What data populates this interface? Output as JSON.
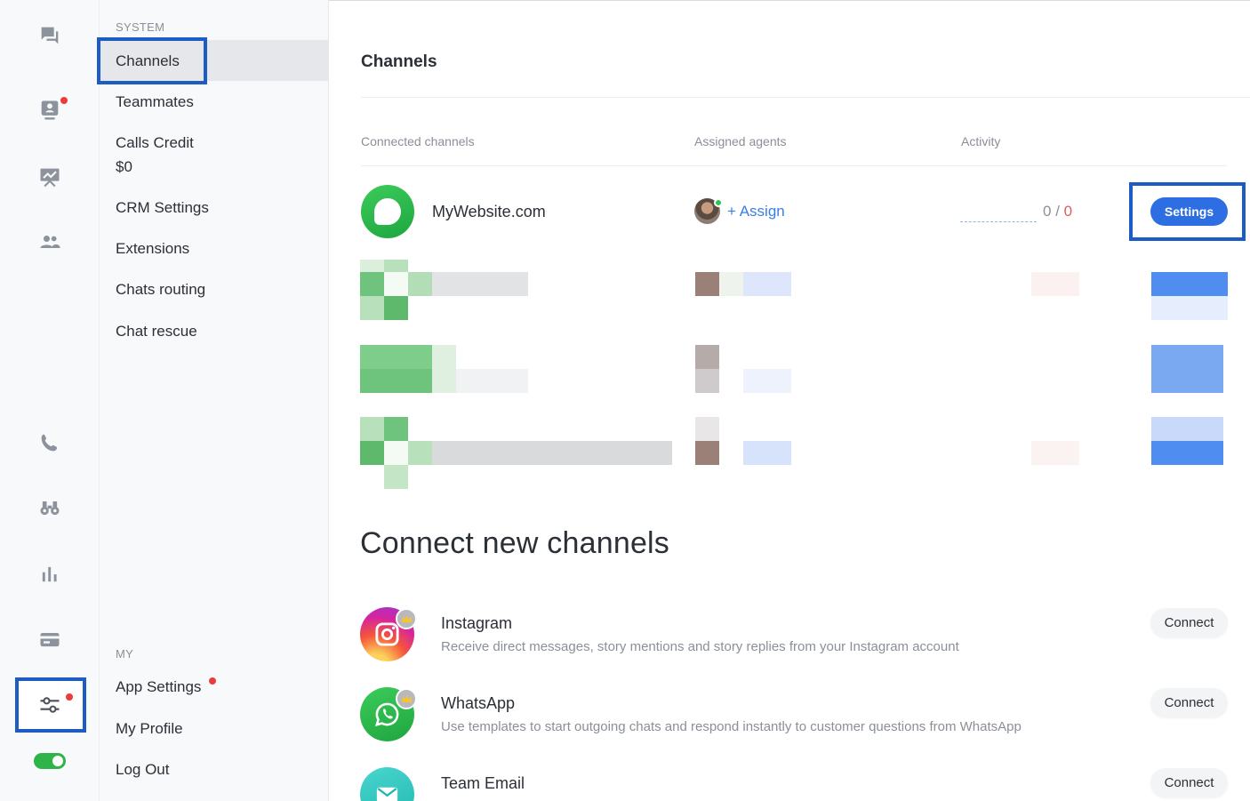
{
  "rail": {
    "icons": [
      "chats-icon",
      "visitors-icon",
      "analytics-board-icon",
      "contacts-icon",
      "phone-icon",
      "binoculars-icon",
      "reports-icon",
      "billing-icon",
      "settings-sliders-icon"
    ],
    "toggle_on": true,
    "accent_color": "#1c5cc4"
  },
  "nav": {
    "system_heading": "SYSTEM",
    "channels": "Channels",
    "teammates": "Teammates",
    "calls_credit": "Calls Credit",
    "calls_credit_value": "$0",
    "crm_settings": "CRM Settings",
    "extensions": "Extensions",
    "chats_routing": "Chats routing",
    "chat_rescue": "Chat rescue",
    "my_heading": "MY",
    "app_settings": "App Settings",
    "my_profile": "My Profile",
    "log_out": "Log Out"
  },
  "main": {
    "title": "Channels",
    "columns": {
      "connected": "Connected channels",
      "agents": "Assigned agents",
      "activity": "Activity"
    },
    "channel": {
      "name": "MyWebsite.com",
      "assign": "+ Assign",
      "activity_a": "0",
      "activity_sep": " / ",
      "activity_b": "0",
      "settings": "Settings"
    },
    "connect_title": "Connect new channels",
    "integrations": [
      {
        "name": "Instagram",
        "desc": "Receive direct messages, story mentions and story replies from your Instagram account",
        "button": "Connect"
      },
      {
        "name": "WhatsApp",
        "desc": "Use templates to start outgoing chats and respond instantly to customer questions from WhatsApp",
        "button": "Connect"
      },
      {
        "name": "Team Email",
        "desc": "",
        "button": "Connect"
      }
    ]
  },
  "colors": {
    "primary": "#2d6fe3",
    "online": "#2fc44f",
    "notification": "#ee3a3a"
  }
}
